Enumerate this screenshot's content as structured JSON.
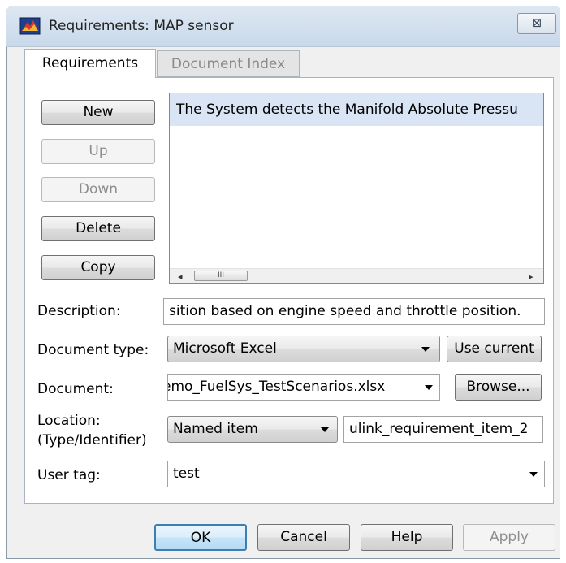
{
  "window": {
    "title": "Requirements: MAP sensor",
    "close_label": "⊠"
  },
  "tabs": [
    {
      "label": "Requirements",
      "active": true
    },
    {
      "label": "Document Index",
      "active": false
    }
  ],
  "side_buttons": {
    "new": "New",
    "up": "Up",
    "down": "Down",
    "delete": "Delete",
    "copy": "Copy"
  },
  "requirements_list": {
    "items": [
      "The System detects the Manifold Absolute Pressu"
    ],
    "scroll_thumb_label": "III"
  },
  "form": {
    "description_label": "Description:",
    "description_value": "sition based on engine speed and throttle position.",
    "doctype_label": "Document type:",
    "doctype_value": "Microsoft Excel",
    "use_current_label": "Use current",
    "document_label": "Document:",
    "document_value": "emo_FuelSys_TestScenarios.xlsx",
    "browse_label": "Browse...",
    "location_label_1": "Location:",
    "location_label_2": "(Type/Identifier)",
    "location_type_value": "Named item",
    "location_id_value": "ulink_requirement_item_2",
    "usertag_label": "User tag:",
    "usertag_value": "test"
  },
  "footer": {
    "ok": "OK",
    "cancel": "Cancel",
    "help": "Help",
    "apply": "Apply"
  },
  "colors": {
    "selection": "#d9e4f4",
    "ok_border": "#3c7fb1"
  }
}
